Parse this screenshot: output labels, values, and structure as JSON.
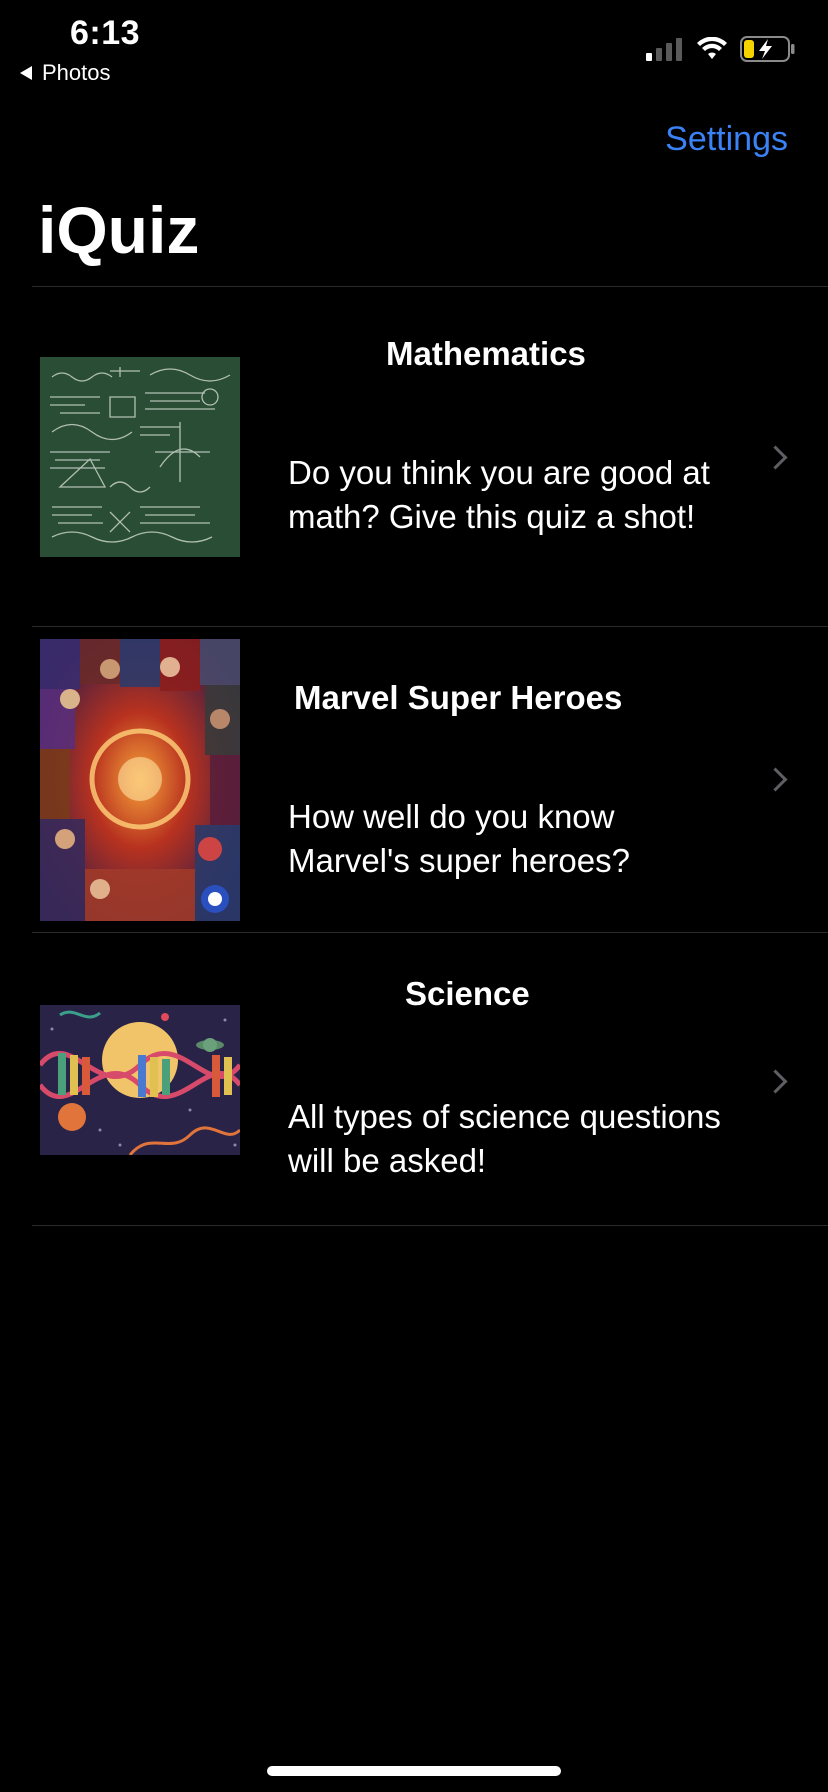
{
  "status_bar": {
    "time": "6:13",
    "back_label": "Photos"
  },
  "nav": {
    "settings_label": "Settings",
    "title": "iQuiz"
  },
  "quizzes": [
    {
      "title": "Mathematics",
      "description": "Do you think you are good at math? Give this quiz a shot!",
      "icon": "chalkboard-math-image"
    },
    {
      "title": "Marvel Super Heroes",
      "description": "How well do you know Marvel's super heroes?",
      "icon": "marvel-collage-image"
    },
    {
      "title": "Science",
      "description": "All types of science questions will be asked!",
      "icon": "dna-space-image"
    }
  ],
  "colors": {
    "accent": "#3b82f6",
    "background": "#000000",
    "separator": "#2a2a2a",
    "battery_charging": "#f5d300"
  }
}
